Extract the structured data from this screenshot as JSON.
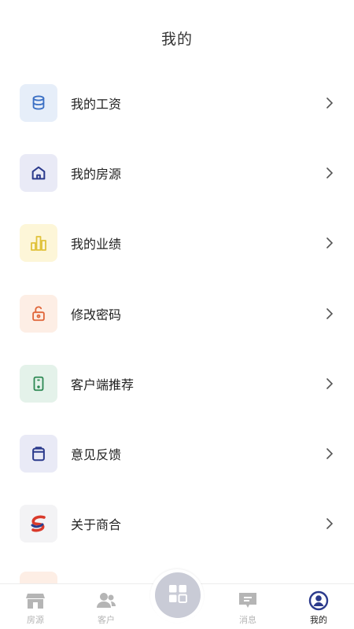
{
  "header": {
    "title": "我的"
  },
  "menu": {
    "items": [
      {
        "label": "我的工资",
        "icon": "database-icon",
        "bg": "#e6eef9",
        "color": "#3a6fc4"
      },
      {
        "label": "我的房源",
        "icon": "home-icon",
        "bg": "#e9eaf6",
        "color": "#2b3a8c"
      },
      {
        "label": "我的业绩",
        "icon": "bar-chart-icon",
        "bg": "#fdf6d8",
        "color": "#e0c23a"
      },
      {
        "label": "修改密码",
        "icon": "unlock-icon",
        "bg": "#fdeee5",
        "color": "#e0663a"
      },
      {
        "label": "客户端推荐",
        "icon": "phone-icon",
        "bg": "#e4f2ea",
        "color": "#2f8a55"
      },
      {
        "label": "意见反馈",
        "icon": "clipboard-icon",
        "bg": "#e9eaf6",
        "color": "#2b3a8c"
      },
      {
        "label": "关于商合",
        "icon": "brand-logo-icon",
        "bg": "#f3f3f5",
        "color": "#d93a2b"
      }
    ]
  },
  "tabbar": {
    "tabs": [
      {
        "label": "房源",
        "icon": "store-icon",
        "active": false
      },
      {
        "label": "客户",
        "icon": "users-icon",
        "active": false
      },
      {
        "label": "消息",
        "icon": "message-icon",
        "active": false
      },
      {
        "label": "我的",
        "icon": "profile-icon",
        "active": true
      }
    ],
    "center_icon": "grid-icon",
    "active_color": "#2b3a8c",
    "inactive_color": "#b5b5b5"
  }
}
